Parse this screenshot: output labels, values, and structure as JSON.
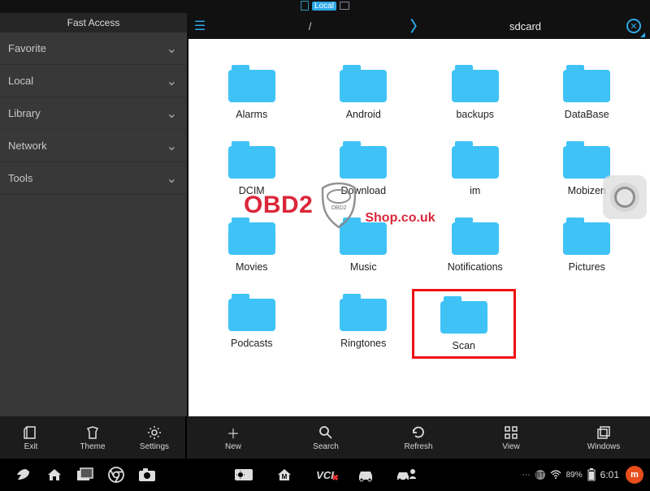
{
  "topbar": {
    "local_label": "Local"
  },
  "sidebar": {
    "title": "Fast Access",
    "items": [
      {
        "label": "Favorite"
      },
      {
        "label": "Local"
      },
      {
        "label": "Library"
      },
      {
        "label": "Network"
      },
      {
        "label": "Tools"
      }
    ]
  },
  "breadcrumb": {
    "root": "/",
    "current": "sdcard"
  },
  "folders": [
    {
      "label": "Alarms"
    },
    {
      "label": "Android"
    },
    {
      "label": "backups"
    },
    {
      "label": "DataBase"
    },
    {
      "label": "DCIM"
    },
    {
      "label": "Download"
    },
    {
      "label": "im"
    },
    {
      "label": "Mobizen"
    },
    {
      "label": "Movies"
    },
    {
      "label": "Music"
    },
    {
      "label": "Notifications"
    },
    {
      "label": "Pictures"
    },
    {
      "label": "Podcasts"
    },
    {
      "label": "Ringtones"
    },
    {
      "label": "Scan",
      "highlighted": true
    }
  ],
  "watermark": {
    "left": "OBD2",
    "right": "Shop.co.uk",
    "badge": "OBD2"
  },
  "toolbar_left": [
    {
      "label": "Exit",
      "icon": "exit"
    },
    {
      "label": "Theme",
      "icon": "theme"
    },
    {
      "label": "Settings",
      "icon": "settings"
    }
  ],
  "toolbar_right": [
    {
      "label": "New",
      "icon": "new"
    },
    {
      "label": "Search",
      "icon": "search"
    },
    {
      "label": "Refresh",
      "icon": "refresh"
    },
    {
      "label": "View",
      "icon": "view"
    },
    {
      "label": "Windows",
      "icon": "windows"
    }
  ],
  "nav": {
    "wifi_pct": "89%",
    "clock": "6:01"
  }
}
